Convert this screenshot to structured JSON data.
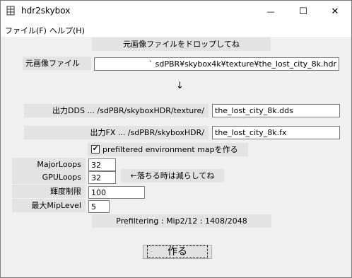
{
  "window": {
    "title": "hdr2skybox",
    "minimize_glyph": "—",
    "maximize_glyph": "☐",
    "close_glyph": "✕"
  },
  "menu": {
    "file": "ファイル(F)",
    "help": "ヘルプ(H)"
  },
  "drop_hint": "元画像ファイルをドロップしてね",
  "source": {
    "label": "元画像ファイル",
    "value": "`                                    sdPBR¥skybox4k¥texture¥the_lost_city_8k.hdr"
  },
  "arrow": "↓",
  "dds": {
    "label": "出力DDS ... /sdPBR/skyboxHDR/texture/",
    "value": "the_lost_city_8k.dds"
  },
  "fx": {
    "label": "出力FX ... /sdPBR/skyboxHDR/",
    "value": "the_lost_city_8k.fx"
  },
  "prefiltered": {
    "label": "prefiltered environment mapを作る",
    "checked": true,
    "check_glyph": "✔"
  },
  "major_loops": {
    "label": "MajorLoops",
    "value": "32"
  },
  "gpu_loops": {
    "label": "GPULoops",
    "value": "32",
    "hint": "←落ちる時は減らしてね"
  },
  "brightness": {
    "label": "輝度制限",
    "value": "100"
  },
  "max_mip": {
    "label": "最大MipLevel",
    "value": "5"
  },
  "status": "Prefiltering : Mip2/12 : 1408/2048",
  "make_button": "作る"
}
